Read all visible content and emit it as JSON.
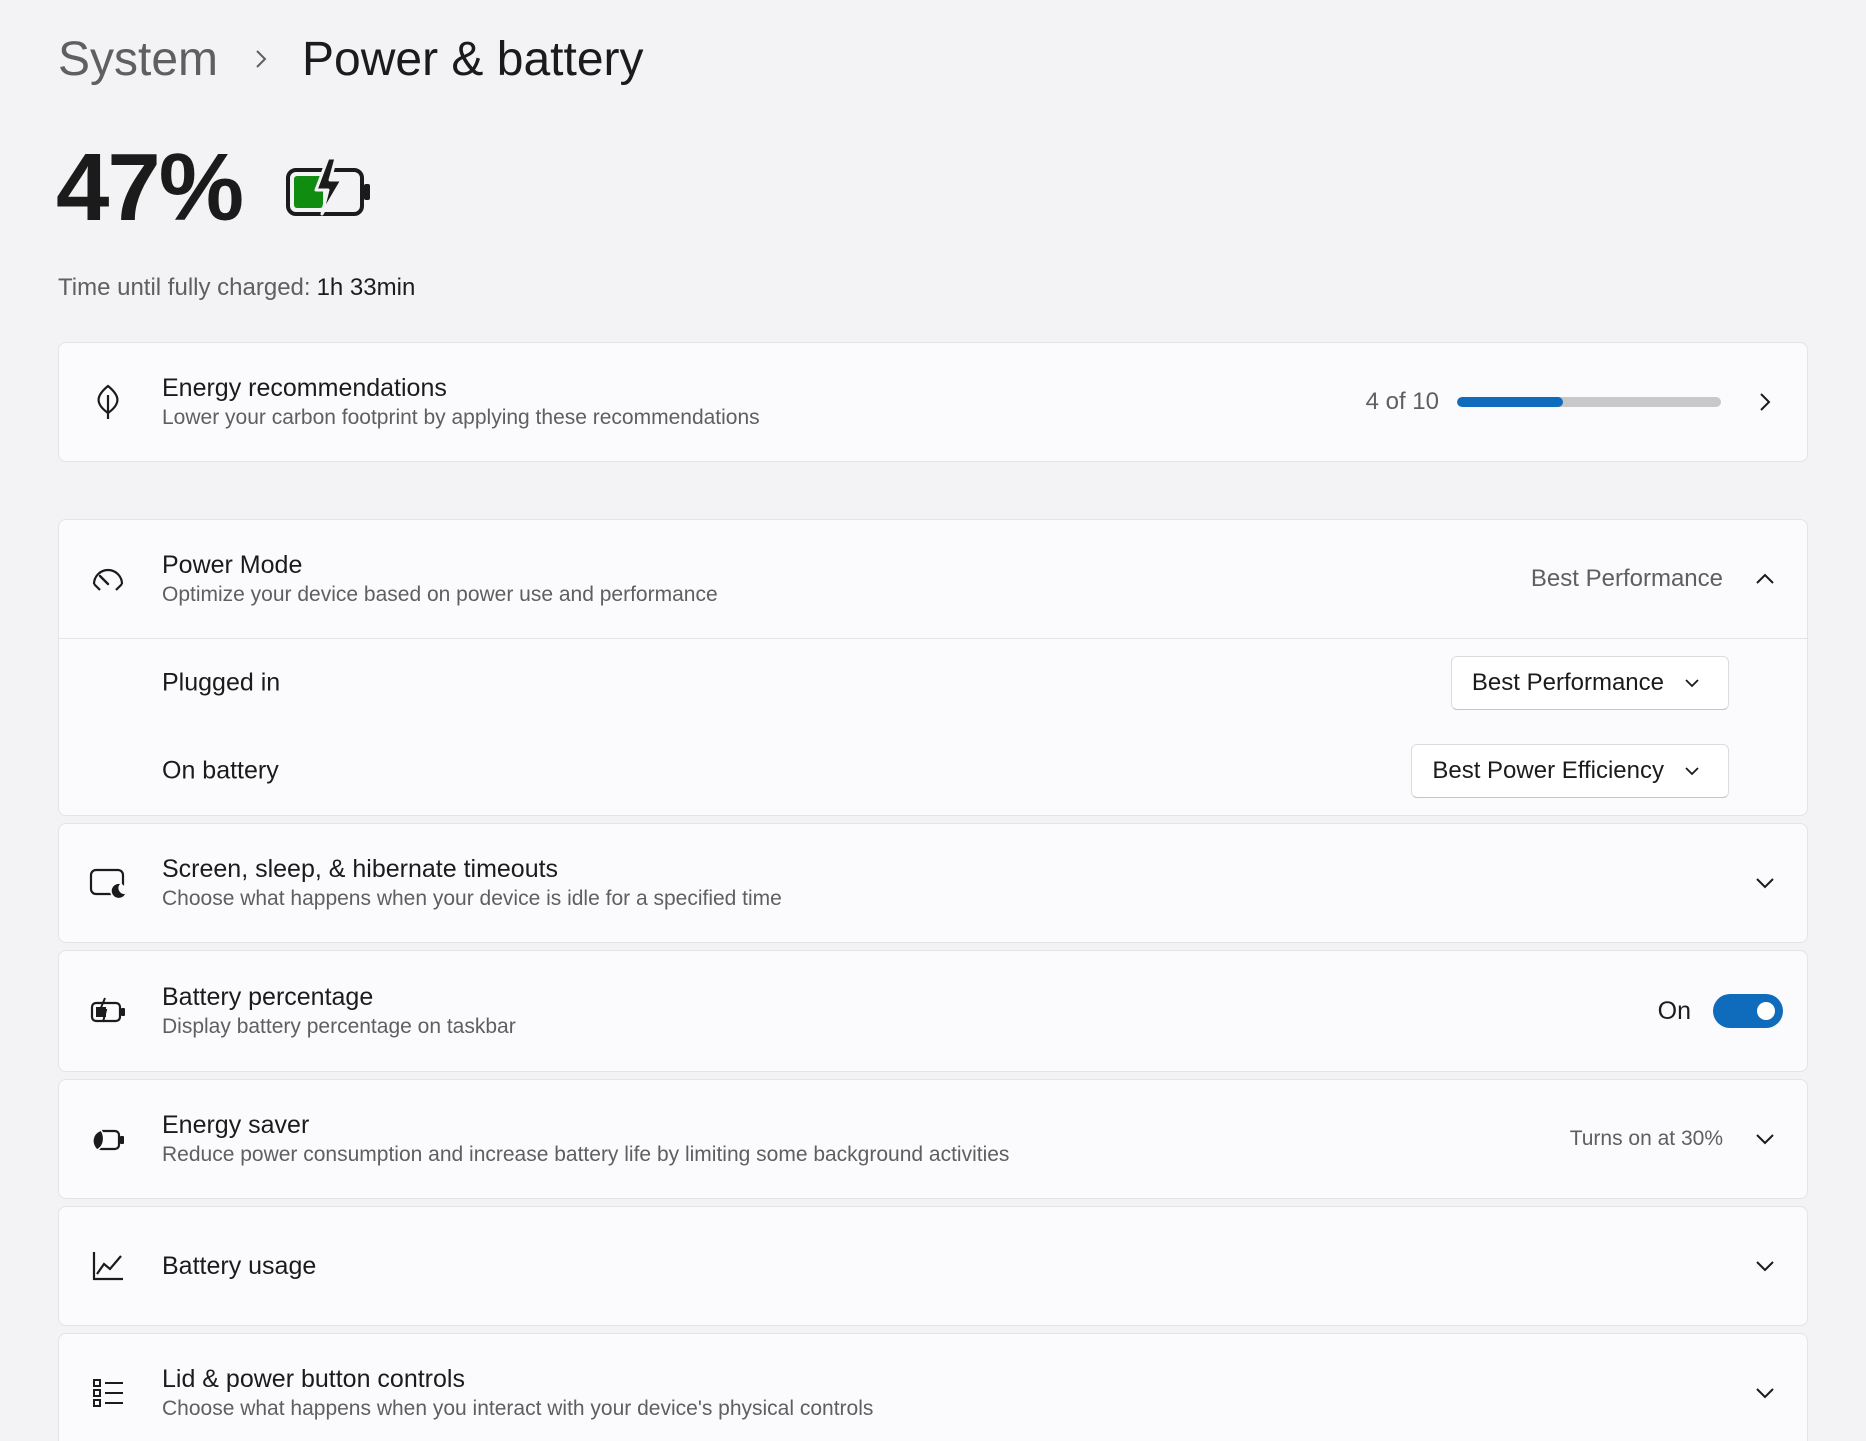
{
  "breadcrumb": {
    "parent": "System",
    "current": "Power & battery"
  },
  "battery": {
    "percent_label": "47%",
    "level": 0.47,
    "charge_label": "Time until fully charged:",
    "charge_value": "1h 33min",
    "fill_color": "#108c10"
  },
  "energy_recommendations": {
    "title": "Energy recommendations",
    "subtitle": "Lower your carbon footprint by applying these recommendations",
    "progress_text": "4 of 10",
    "progress_value": 0.4
  },
  "power_mode": {
    "title": "Power Mode",
    "subtitle": "Optimize your device based on power use and performance",
    "current": "Best Performance",
    "plugged_in_label": "Plugged in",
    "plugged_in_value": "Best Performance",
    "on_battery_label": "On battery",
    "on_battery_value": "Best Power Efficiency"
  },
  "screen_sleep": {
    "title": "Screen, sleep, & hibernate timeouts",
    "subtitle": "Choose what happens when your device is idle for a specified time"
  },
  "battery_percentage": {
    "title": "Battery percentage",
    "subtitle": "Display battery percentage on taskbar",
    "state": "On"
  },
  "energy_saver": {
    "title": "Energy saver",
    "subtitle": "Reduce power consumption and increase battery life by limiting some background activities",
    "status": "Turns on at 30%"
  },
  "battery_usage": {
    "title": "Battery usage"
  },
  "lid_power": {
    "title": "Lid & power button controls",
    "subtitle": "Choose what happens when you interact with your device's physical controls"
  },
  "colors": {
    "accent": "#0f6cbd",
    "battery_green": "#108c10"
  }
}
